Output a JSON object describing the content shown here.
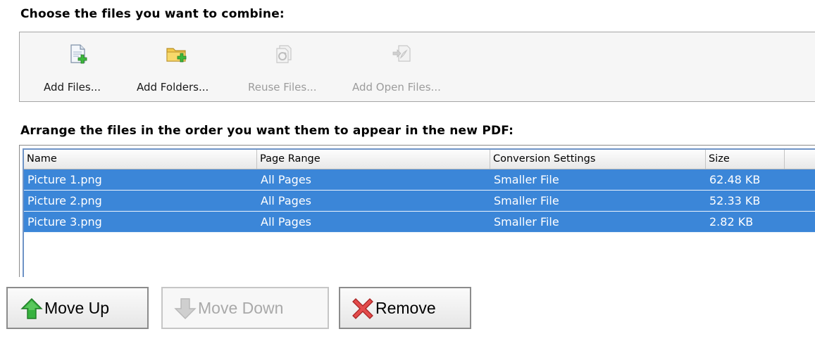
{
  "headings": {
    "choose": "Choose the files you want to combine:",
    "arrange": "Arrange the files in the order you want them to appear in the new PDF:"
  },
  "toolbar": {
    "items": [
      {
        "label": "Add Files...",
        "icon": "add-file-icon",
        "enabled": true
      },
      {
        "label": "Add Folders...",
        "icon": "add-folder-icon",
        "enabled": true
      },
      {
        "label": "Reuse Files...",
        "icon": "reuse-files-icon",
        "enabled": false
      },
      {
        "label": "Add Open Files...",
        "icon": "add-open-files-icon",
        "enabled": false
      }
    ]
  },
  "file_list": {
    "columns": [
      "Name",
      "Page Range",
      "Conversion Settings",
      "Size"
    ],
    "rows": [
      {
        "name": "Picture 1.png",
        "page_range": "All Pages",
        "conversion": "Smaller File",
        "size": "62.48 KB",
        "selected": true
      },
      {
        "name": "Picture 2.png",
        "page_range": "All Pages",
        "conversion": "Smaller File",
        "size": "52.33 KB",
        "selected": true
      },
      {
        "name": "Picture 3.png",
        "page_range": "All Pages",
        "conversion": "Smaller File",
        "size": "2.82 KB",
        "selected": true
      }
    ]
  },
  "buttons": {
    "move_up": {
      "label": "Move Up",
      "icon": "arrow-up-icon",
      "enabled": true
    },
    "move_down": {
      "label": "Move Down",
      "icon": "arrow-down-icon",
      "enabled": false
    },
    "remove": {
      "label": "Remove",
      "icon": "x-remove-icon",
      "enabled": true
    }
  },
  "colors": {
    "selection": "#3b86d8",
    "add_green": "#3cb93c",
    "remove_red": "#e03a3a",
    "move_up_green": "#2fa83a"
  }
}
